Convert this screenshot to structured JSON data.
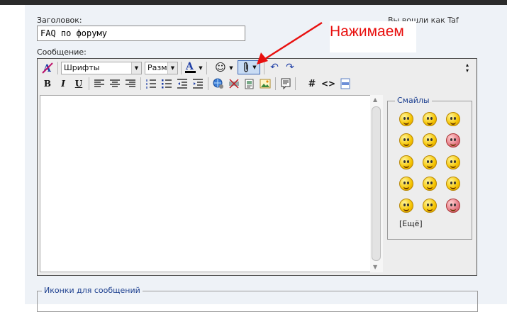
{
  "form": {
    "title_label": "Заголовок:",
    "title_value": "FAQ по форуму",
    "message_label": "Сообщение:",
    "logged_in_text": "Вы вошли как Taf"
  },
  "annotation": {
    "text": "Нажимаем",
    "color": "#e8100f"
  },
  "toolbar": {
    "font_combo": "Шрифты",
    "size_combo": "Разме",
    "bold": "B",
    "italic": "I",
    "underline": "U",
    "hash": "#",
    "code": "<>"
  },
  "smilies": {
    "legend": "Смайлы",
    "more": "[Ещё]"
  },
  "icons_section": {
    "legend": "Иконки для сообщений"
  }
}
